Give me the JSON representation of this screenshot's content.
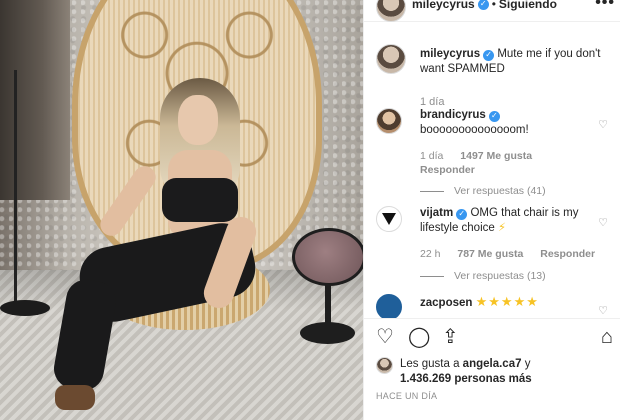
{
  "header": {
    "username": "mileycyrus",
    "separator": "•",
    "follow_status": "Siguiendo",
    "more_icon": "•••"
  },
  "caption": {
    "username": "mileycyrus",
    "text": "Mute me if you don't want SPAMMED",
    "time": "1 día"
  },
  "comments": [
    {
      "username": "brandicyrus",
      "text": "boooooooooooooom!",
      "time": "1 día",
      "likes": "1497 Me gusta",
      "reply_label": "Responder",
      "view_replies": "Ver respuestas (41)"
    },
    {
      "username": "vijatm",
      "text": "OMG that chair is my lifestyle choice",
      "emoji": "⚡",
      "time": "22 h",
      "likes": "787 Me gusta",
      "reply_label": "Responder",
      "view_replies": "Ver respuestas (13)"
    },
    {
      "username": "zacposen",
      "stars": "★★★★★"
    }
  ],
  "actions": {
    "heart_icon": "♡",
    "comment_icon": "◯",
    "share_icon": "⇪",
    "save_icon": "⌂"
  },
  "likes": {
    "prefix": "Les gusta a",
    "user": "angela.ca7",
    "conjunction": "y",
    "count": "1.436.269 personas más"
  },
  "time_ago": "HACE UN DÍA",
  "colors": {
    "verified": "#3897f0",
    "muted_text": "#8e8e8e",
    "text": "#262626"
  }
}
